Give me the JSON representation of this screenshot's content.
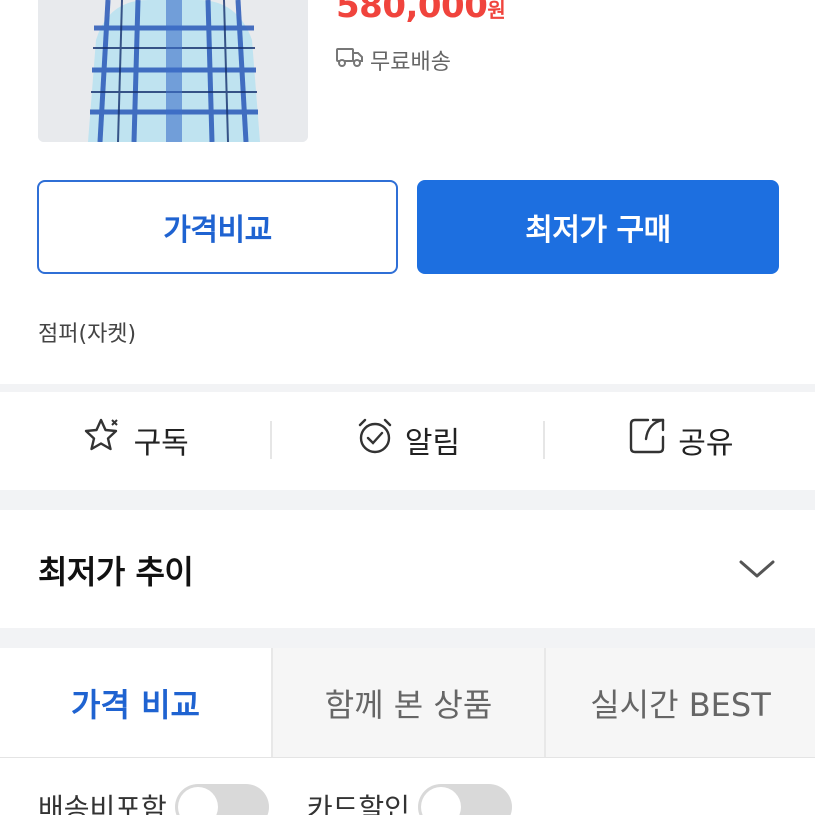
{
  "product": {
    "price": "580,000",
    "price_unit": "원",
    "shipping_label": "무료배송",
    "category": "점퍼(자켓)"
  },
  "buttons": {
    "compare_label": "가격비교",
    "buy_label": "최저가 구매"
  },
  "actions": {
    "subscribe_label": "구독",
    "alarm_label": "알림",
    "share_label": "공유"
  },
  "trend": {
    "title": "최저가 추이"
  },
  "tabs": [
    {
      "label": "가격 비교",
      "active": true
    },
    {
      "label": "함께 본 상품",
      "active": false
    },
    {
      "label": "실시간 BEST",
      "active": false
    }
  ],
  "filters": {
    "shipping_included_label": "배송비포함",
    "card_discount_label": "카드할인"
  },
  "colors": {
    "price": "#f0443d",
    "accent": "#1d6fe0"
  }
}
